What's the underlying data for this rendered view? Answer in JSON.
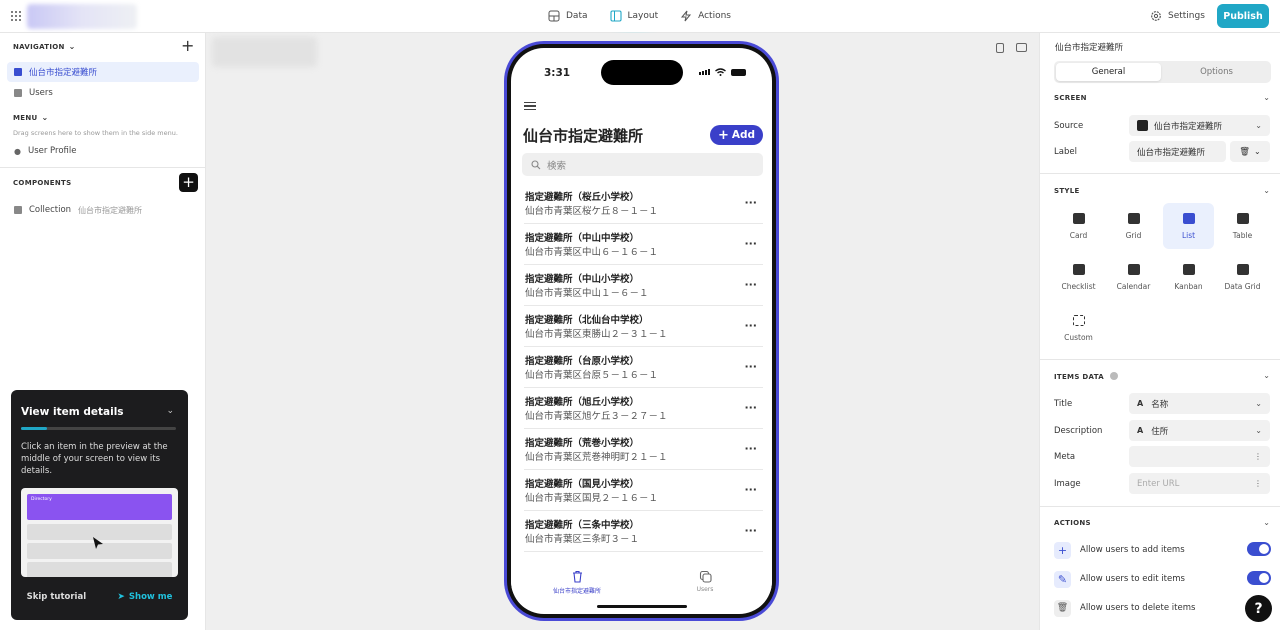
{
  "topbar": {
    "tabs": [
      {
        "label": "Data"
      },
      {
        "label": "Layout"
      },
      {
        "label": "Actions"
      }
    ],
    "settings_label": "Settings",
    "publish_label": "Publish"
  },
  "sidebar": {
    "navigation_header": "NAVIGATION",
    "nav_items": [
      {
        "label": "仙台市指定避難所",
        "selected": true
      },
      {
        "label": "Users"
      }
    ],
    "menu_header": "MENU",
    "menu_hint": "Drag screens here to show them in the side menu.",
    "menu_items": [
      {
        "label": "User Profile"
      }
    ],
    "components_header": "COMPONENTS",
    "components": [
      {
        "type": "Collection",
        "source": "仙台市指定避難所"
      }
    ]
  },
  "tutorial": {
    "title": "View item details",
    "body": "Click an item in the preview at the middle of your screen to view its details.",
    "preview_header": "Directory",
    "skip_label": "Skip tutorial",
    "show_label": "Show me"
  },
  "phone": {
    "time": "3:31",
    "title": "仙台市指定避難所",
    "add_label": "Add",
    "search_placeholder": "検索",
    "items": [
      {
        "title": "指定避難所（桜丘小学校）",
        "desc": "仙台市青葉区桜ケ丘８－１－１"
      },
      {
        "title": "指定避難所（中山中学校）",
        "desc": "仙台市青葉区中山６－１６－１"
      },
      {
        "title": "指定避難所（中山小学校）",
        "desc": "仙台市青葉区中山１－６－１"
      },
      {
        "title": "指定避難所（北仙台中学校）",
        "desc": "仙台市青葉区東勝山２－３１－１"
      },
      {
        "title": "指定避難所（台原小学校）",
        "desc": "仙台市青葉区台原５－１６－１"
      },
      {
        "title": "指定避難所（旭丘小学校）",
        "desc": "仙台市青葉区旭ケ丘３－２７－１"
      },
      {
        "title": "指定避難所（荒巻小学校）",
        "desc": "仙台市青葉区荒巻神明町２１－１"
      },
      {
        "title": "指定避難所（国見小学校）",
        "desc": "仙台市青葉区国見２－１６－１"
      },
      {
        "title": "指定避難所（三条中学校）",
        "desc": "仙台市青葉区三条町３－１"
      }
    ],
    "tabs": [
      {
        "label": "仙台市指定避難所"
      },
      {
        "label": "Users"
      }
    ]
  },
  "right": {
    "title": "仙台市指定避難所",
    "seg_general": "General",
    "seg_options": "Options",
    "screen_header": "SCREEN",
    "source_label": "Source",
    "source_value": "仙台市指定避難所",
    "label_label": "Label",
    "label_value": "仙台市指定避難所",
    "style_header": "STYLE",
    "styles": [
      {
        "label": "Card"
      },
      {
        "label": "Grid"
      },
      {
        "label": "List",
        "selected": true
      },
      {
        "label": "Table"
      },
      {
        "label": "Checklist"
      },
      {
        "label": "Calendar"
      },
      {
        "label": "Kanban"
      },
      {
        "label": "Data Grid"
      },
      {
        "label": "Custom"
      }
    ],
    "items_data_header": "ITEMS DATA",
    "title_label": "Title",
    "title_value": "名称",
    "desc_label": "Description",
    "desc_value": "住所",
    "meta_label": "Meta",
    "image_label": "Image",
    "image_placeholder": "Enter URL",
    "actions_header": "ACTIONS",
    "actions": [
      {
        "label": "Allow users to add items",
        "enabled": true
      },
      {
        "label": "Allow users to edit items",
        "enabled": true
      },
      {
        "label": "Allow users to delete items"
      }
    ]
  },
  "colors": {
    "accent": "#20a7c6",
    "primary": "#3a3fc9",
    "phone_frame": "#4a4ad6"
  }
}
